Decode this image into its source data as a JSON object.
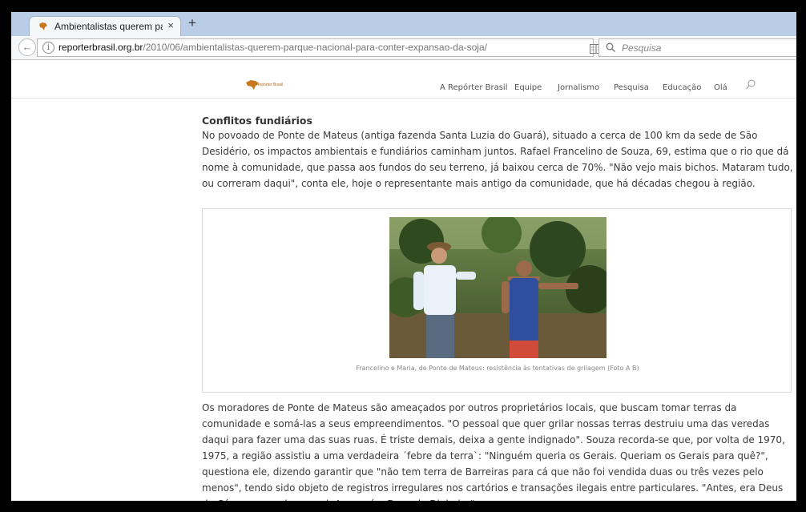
{
  "browser": {
    "tab_title": "Ambientalistas querem par...",
    "tab_close": "×",
    "new_tab": "+",
    "back": "←",
    "url_domain": "reporterbrasil.org.br",
    "url_path": "/2010/06/ambientalistas-querem-parque-nacional-para-conter-expansao-da-soja/",
    "reload": "C",
    "search_placeholder": "Pesquisa"
  },
  "site": {
    "logo_text": "Repórter Brasil",
    "nav": [
      "A Repórter Brasil",
      "Equipe",
      "Jornalismo",
      "Pesquisa",
      "Educação",
      "Olá"
    ]
  },
  "article": {
    "heading": "Conflitos fundiários",
    "paragraph1": "No povoado de Ponte de Mateus (antiga fazenda Santa Luzia do Guará), situado a cerca de 100 km da sede de São Desidério, os impactos ambientais e fundiários caminham juntos. Rafael Francelino de Souza, 69, estima que o rio que dá nome à comunidade, que passa aos fundos do seu terreno, já baixou cerca de 70%. \"Não vejo mais bichos. Mataram tudo, ou correram daqui\", conta ele, hoje o representante mais antigo da comunidade, que há décadas chegou à região.",
    "photo_caption": "Francelino e Maria, de Ponte de Mateus: resistência às tentativas de grilagem (Foto A B)",
    "paragraph2": "Os moradores de Ponte de Mateus são ameaçados por outros proprietários locais, que buscam tomar terras da comunidade e somá-las a seus empreendimentos. \"O pessoal que quer grilar nossas terras destruiu uma das veredas daqui para fazer uma das suas ruas. É triste demais, deixa a gente indignado\". Souza recorda-se que, por volta de 1970, 1975, a região assistiu a uma verdadeira ´febre da terra`: \"Ninguém queria os Gerais. Queriam os Gerais para quê?\", questiona ele, dizendo garantir que \"não tem terra de Barreiras para cá que não foi vendida duas ou três vezes pelo menos\", tendo sido objeto de registros irregulares nos cartórios e transações ilegais entre particulares. \"Antes, era Deus do Céu que mandava aqui. Agora, é o Deus do Dinheiro\"."
  }
}
